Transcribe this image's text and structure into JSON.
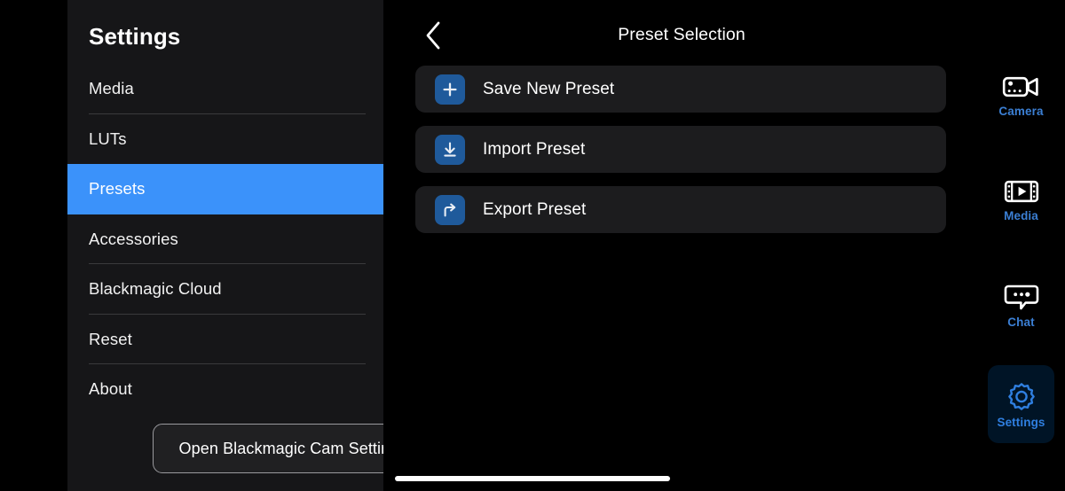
{
  "sidebar": {
    "title": "Settings",
    "items": [
      {
        "label": "Media",
        "selected": false
      },
      {
        "label": "LUTs",
        "selected": false
      },
      {
        "label": "Presets",
        "selected": true
      },
      {
        "label": "Accessories",
        "selected": false
      },
      {
        "label": "Blackmagic Cloud",
        "selected": false
      },
      {
        "label": "Reset",
        "selected": false
      },
      {
        "label": "About",
        "selected": false
      }
    ],
    "open_cam_settings_label": "Open Blackmagic Cam Settings"
  },
  "main": {
    "back_icon": "chevron-left-icon",
    "title": "Preset Selection",
    "rows": [
      {
        "icon": "plus-icon",
        "label": "Save New Preset"
      },
      {
        "icon": "download-icon",
        "label": "Import Preset"
      },
      {
        "icon": "share-icon",
        "label": "Export Preset"
      }
    ]
  },
  "rail": {
    "tabs": [
      {
        "label": "Camera",
        "icon": "video-camera-icon",
        "active": false
      },
      {
        "label": "Media",
        "icon": "film-play-icon",
        "active": false
      },
      {
        "label": "Chat",
        "icon": "chat-bubble-icon",
        "active": false
      },
      {
        "label": "Settings",
        "icon": "gear-icon",
        "active": true
      }
    ]
  },
  "colors": {
    "accent_blue": "#3b92fa",
    "icon_blue": "#1f5a9b",
    "rail_blue": "#3b7fd4",
    "active_tab_bg": "#001426",
    "sidebar_bg": "#161618",
    "row_bg": "#1c1c1e",
    "screen_bg": "#000000"
  },
  "home_indicator": "home-indicator"
}
